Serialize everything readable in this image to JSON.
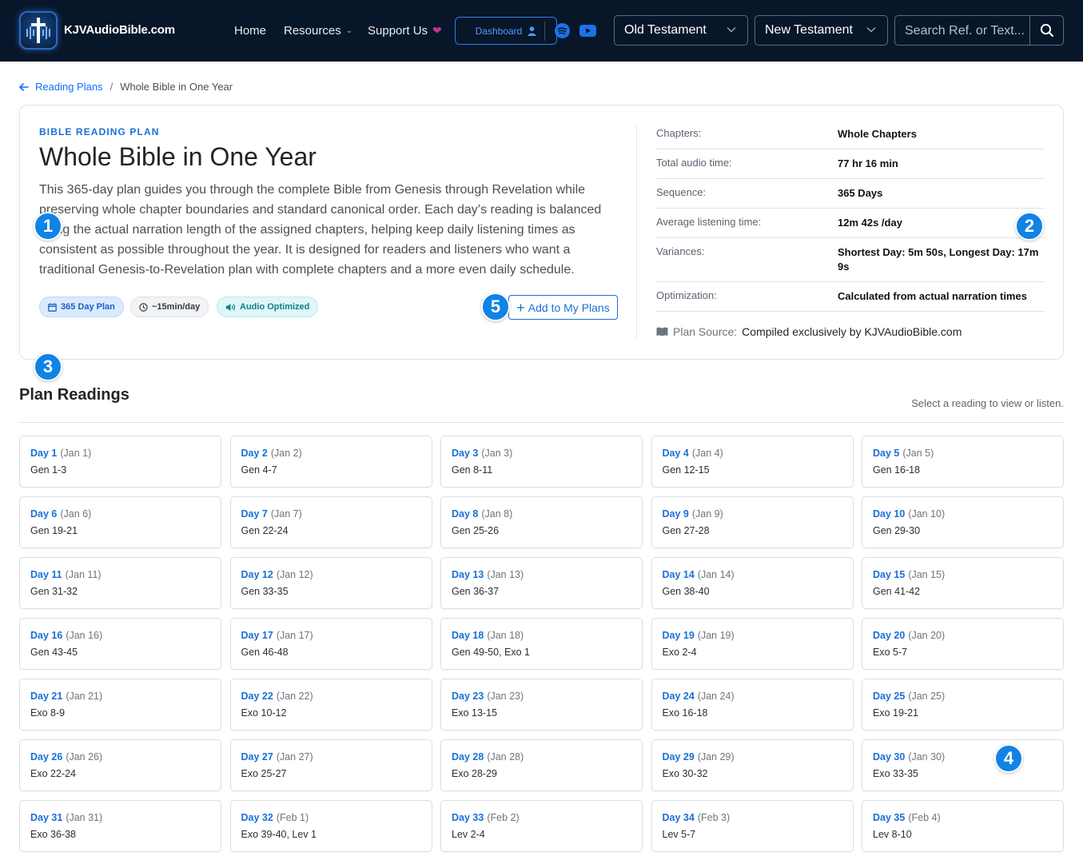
{
  "brand": {
    "name": "KJVAudioBible.com"
  },
  "nav": {
    "home": "Home",
    "resources": "Resources",
    "support": "Support Us",
    "dashboard": "Dashboard",
    "old_testament": "Old Testament",
    "new_testament": "New Testament",
    "search_placeholder": "Search Ref. or Text..."
  },
  "breadcrumb": {
    "parent": "Reading Plans",
    "separator": "/",
    "current": "Whole Bible in One Year"
  },
  "plan": {
    "eyebrow": "BIBLE READING PLAN",
    "title": "Whole Bible in One Year",
    "description": "This 365-day plan guides you through the complete Bible from Genesis through Revelation while preserving whole chapter boundaries and standard canonical order. Each day’s reading is balanced using the actual narration length of the assigned chapters, helping keep daily listening times as consistent as possible throughout the year. It is designed for readers and listeners who want a traditional Genesis-to-Revelation plan with complete chapters and a more even daily schedule.",
    "badges": [
      "365 Day Plan",
      "~15min/day",
      "Audio Optimized"
    ],
    "add_button": "Add to My Plans",
    "stats": [
      {
        "label": "Chapters:",
        "value": "Whole Chapters"
      },
      {
        "label": "Total audio time:",
        "value": "77 hr 16 min"
      },
      {
        "label": "Sequence:",
        "value": "365 Days"
      },
      {
        "label": "Average listening time:",
        "value": "12m 42s /day"
      },
      {
        "label": "Variances:",
        "value": "Shortest Day: 5m 50s, Longest Day: 17m 9s"
      },
      {
        "label": "Optimization:",
        "value": "Calculated from actual narration times"
      }
    ],
    "source_label": "Plan Source:",
    "source_value": "Compiled exclusively by KJVAudioBible.com"
  },
  "markers": [
    "1",
    "2",
    "3",
    "4",
    "5"
  ],
  "readings_section": {
    "title": "Plan Readings",
    "hint": "Select a reading to view or listen."
  },
  "readings": [
    {
      "day": "Day 1",
      "date": "(Jan 1)",
      "ref": "Gen 1-3"
    },
    {
      "day": "Day 2",
      "date": "(Jan 2)",
      "ref": "Gen 4-7"
    },
    {
      "day": "Day 3",
      "date": "(Jan 3)",
      "ref": "Gen 8-11"
    },
    {
      "day": "Day 4",
      "date": "(Jan 4)",
      "ref": "Gen 12-15"
    },
    {
      "day": "Day 5",
      "date": "(Jan 5)",
      "ref": "Gen 16-18"
    },
    {
      "day": "Day 6",
      "date": "(Jan 6)",
      "ref": "Gen 19-21"
    },
    {
      "day": "Day 7",
      "date": "(Jan 7)",
      "ref": "Gen 22-24"
    },
    {
      "day": "Day 8",
      "date": "(Jan 8)",
      "ref": "Gen 25-26"
    },
    {
      "day": "Day 9",
      "date": "(Jan 9)",
      "ref": "Gen 27-28"
    },
    {
      "day": "Day 10",
      "date": "(Jan 10)",
      "ref": "Gen 29-30"
    },
    {
      "day": "Day 11",
      "date": "(Jan 11)",
      "ref": "Gen 31-32"
    },
    {
      "day": "Day 12",
      "date": "(Jan 12)",
      "ref": "Gen 33-35"
    },
    {
      "day": "Day 13",
      "date": "(Jan 13)",
      "ref": "Gen 36-37"
    },
    {
      "day": "Day 14",
      "date": "(Jan 14)",
      "ref": "Gen 38-40"
    },
    {
      "day": "Day 15",
      "date": "(Jan 15)",
      "ref": "Gen 41-42"
    },
    {
      "day": "Day 16",
      "date": "(Jan 16)",
      "ref": "Gen 43-45"
    },
    {
      "day": "Day 17",
      "date": "(Jan 17)",
      "ref": "Gen 46-48"
    },
    {
      "day": "Day 18",
      "date": "(Jan 18)",
      "ref": "Gen 49-50, Exo 1"
    },
    {
      "day": "Day 19",
      "date": "(Jan 19)",
      "ref": "Exo 2-4"
    },
    {
      "day": "Day 20",
      "date": "(Jan 20)",
      "ref": "Exo 5-7"
    },
    {
      "day": "Day 21",
      "date": "(Jan 21)",
      "ref": "Exo 8-9"
    },
    {
      "day": "Day 22",
      "date": "(Jan 22)",
      "ref": "Exo 10-12"
    },
    {
      "day": "Day 23",
      "date": "(Jan 23)",
      "ref": "Exo 13-15"
    },
    {
      "day": "Day 24",
      "date": "(Jan 24)",
      "ref": "Exo 16-18"
    },
    {
      "day": "Day 25",
      "date": "(Jan 25)",
      "ref": "Exo 19-21"
    },
    {
      "day": "Day 26",
      "date": "(Jan 26)",
      "ref": "Exo 22-24"
    },
    {
      "day": "Day 27",
      "date": "(Jan 27)",
      "ref": "Exo 25-27"
    },
    {
      "day": "Day 28",
      "date": "(Jan 28)",
      "ref": "Exo 28-29"
    },
    {
      "day": "Day 29",
      "date": "(Jan 29)",
      "ref": "Exo 30-32"
    },
    {
      "day": "Day 30",
      "date": "(Jan 30)",
      "ref": "Exo 33-35"
    },
    {
      "day": "Day 31",
      "date": "(Jan 31)",
      "ref": "Exo 36-38"
    },
    {
      "day": "Day 32",
      "date": "(Feb 1)",
      "ref": "Exo 39-40, Lev 1"
    },
    {
      "day": "Day 33",
      "date": "(Feb 2)",
      "ref": "Lev 2-4"
    },
    {
      "day": "Day 34",
      "date": "(Feb 3)",
      "ref": "Lev 5-7"
    },
    {
      "day": "Day 35",
      "date": "(Feb 4)",
      "ref": "Lev 8-10"
    }
  ],
  "icons": {
    "logo": "bible-cross-logo-icon",
    "search": "search-icon",
    "spotify": "spotify-icon",
    "youtube": "youtube-icon",
    "user": "user-icon",
    "heart": "heart-icon",
    "back": "arrow-left-icon",
    "calendar": "calendar-icon",
    "clock": "clock-icon",
    "audio": "speaker-icon",
    "book": "book-icon"
  },
  "colors": {
    "navbar": "#081629",
    "accent": "#1a6fd6",
    "marker": "#1183e6",
    "heart": "#c2348f",
    "spotify": "#1a73e8"
  }
}
